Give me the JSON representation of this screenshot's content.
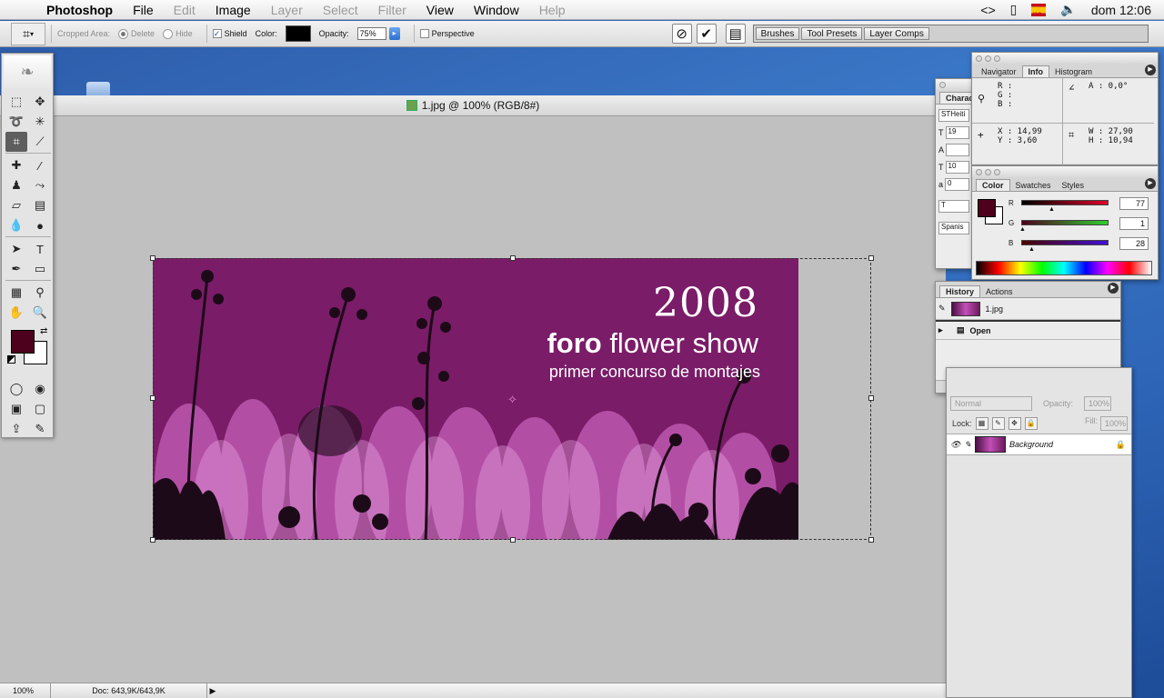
{
  "menubar": {
    "app_name": "Photoshop",
    "menus": [
      "File",
      "Edit",
      "Image",
      "Layer",
      "Select",
      "Filter",
      "View",
      "Window",
      "Help"
    ],
    "clock": "dom 12:06",
    "input_source": "ISO"
  },
  "options_bar": {
    "cropped_area_label": "Cropped Area:",
    "delete_label": "Delete",
    "hide_label": "Hide",
    "shield_label": "Shield",
    "color_label": "Color:",
    "shield_color": "#000000",
    "opacity_label": "Opacity:",
    "opacity_value": "75%",
    "perspective_label": "Perspective",
    "palette_well_tabs": [
      "Brushes",
      "Tool Presets",
      "Layer Comps"
    ]
  },
  "document": {
    "title": "1.jpg @ 100% (RGB/8#)",
    "zoom": "100%",
    "doc_info": "Doc: 643,9K/643,9K"
  },
  "artwork": {
    "year": "2008",
    "title_bold": "foro",
    "title_rest": " flower show",
    "subtitle": "primer concurso de montajes",
    "background_color": "#7a1c68"
  },
  "toolbox": {
    "foreground_color": "#4d011c",
    "background_color": "#ffffff"
  },
  "character_palette": {
    "tab_label": "Charac",
    "font": "STHeiti",
    "size": "19",
    "leading": "10",
    "tracking": "0",
    "language": "Spanis"
  },
  "info_palette": {
    "tabs": [
      "Navigator",
      "Info",
      "Histogram"
    ],
    "active_tab": "Info",
    "rgb_labels": [
      "R :",
      "G :",
      "B :"
    ],
    "angle": "A :   0,0°",
    "x": "X :  14,99",
    "y": "Y :   3,60",
    "w": "W :  27,90",
    "h": "H :  10,94"
  },
  "color_palette": {
    "tabs": [
      "Color",
      "Swatches",
      "Styles"
    ],
    "active_tab": "Color",
    "channels": [
      {
        "label": "R",
        "value": "77",
        "color": "#e0002a"
      },
      {
        "label": "G",
        "value": "1",
        "color": "#2fd12f"
      },
      {
        "label": "B",
        "value": "28",
        "color": "#4010d8"
      }
    ]
  },
  "history_palette": {
    "tabs": [
      "History",
      "Actions"
    ],
    "active_tab": "History",
    "snapshot_name": "1.jpg",
    "states": [
      "Open"
    ]
  },
  "layers_palette": {
    "blend_mode": "Normal",
    "opacity_label": "Opacity:",
    "opacity_value": "100%",
    "lock_label": "Lock:",
    "fill_label": "Fill:",
    "fill_value": "100%",
    "layer_name": "Background"
  }
}
